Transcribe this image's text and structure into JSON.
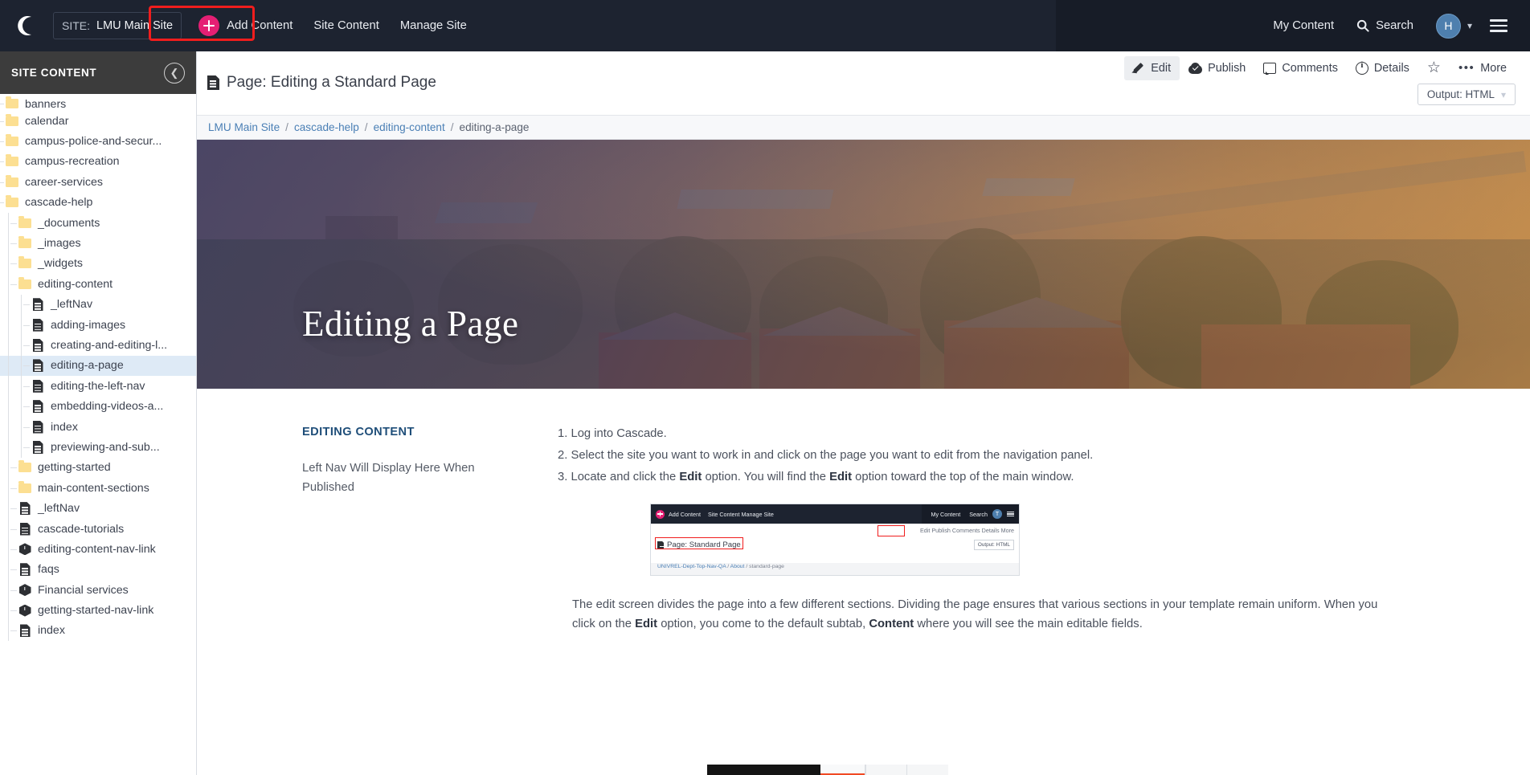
{
  "topbar": {
    "logo_icon": "crescent-moon-logo",
    "site_label": "SITE:",
    "site_value": "LMU Main Site",
    "add_content": "Add Content",
    "nav": [
      {
        "label": "Site Content"
      },
      {
        "label": "Manage Site"
      }
    ],
    "my_content": "My Content",
    "search": "Search",
    "avatar_initial": "H",
    "accent_pink": "#e51f74",
    "bar_bg": "#1d2330",
    "highlight_box_color": "#f01d1d"
  },
  "sidebar": {
    "header": "SITE CONTENT",
    "collapse_icon": "chevron-left-icon",
    "items": [
      {
        "label": "banners",
        "type": "folder",
        "depth": 1,
        "selected": false,
        "clipped": true
      },
      {
        "label": "calendar",
        "type": "folder",
        "depth": 1,
        "selected": false
      },
      {
        "label": "campus-police-and-secur...",
        "type": "folder",
        "depth": 1,
        "selected": false
      },
      {
        "label": "campus-recreation",
        "type": "folder",
        "depth": 1,
        "selected": false
      },
      {
        "label": "career-services",
        "type": "folder",
        "depth": 1,
        "selected": false
      },
      {
        "label": "cascade-help",
        "type": "folder",
        "depth": 1,
        "selected": false
      },
      {
        "label": "_documents",
        "type": "folder",
        "depth": 2,
        "selected": false
      },
      {
        "label": "_images",
        "type": "folder",
        "depth": 2,
        "selected": false
      },
      {
        "label": "_widgets",
        "type": "folder",
        "depth": 2,
        "selected": false
      },
      {
        "label": "editing-content",
        "type": "folder",
        "depth": 2,
        "selected": false
      },
      {
        "label": "_leftNav",
        "type": "page",
        "depth": 3,
        "selected": false
      },
      {
        "label": "adding-images",
        "type": "page",
        "depth": 3,
        "selected": false
      },
      {
        "label": "creating-and-editing-l...",
        "type": "page",
        "depth": 3,
        "selected": false
      },
      {
        "label": "editing-a-page",
        "type": "page",
        "depth": 3,
        "selected": true
      },
      {
        "label": "editing-the-left-nav",
        "type": "page",
        "depth": 3,
        "selected": false
      },
      {
        "label": "embedding-videos-a...",
        "type": "page",
        "depth": 3,
        "selected": false
      },
      {
        "label": "index",
        "type": "page",
        "depth": 3,
        "selected": false
      },
      {
        "label": "previewing-and-sub...",
        "type": "page",
        "depth": 3,
        "selected": false
      },
      {
        "label": "getting-started",
        "type": "folder",
        "depth": 2,
        "selected": false
      },
      {
        "label": "main-content-sections",
        "type": "folder",
        "depth": 2,
        "selected": false
      },
      {
        "label": "_leftNav",
        "type": "page",
        "depth": 2,
        "selected": false
      },
      {
        "label": "cascade-tutorials",
        "type": "page",
        "depth": 2,
        "selected": false
      },
      {
        "label": "editing-content-nav-link",
        "type": "block",
        "depth": 2,
        "selected": false
      },
      {
        "label": "faqs",
        "type": "page",
        "depth": 2,
        "selected": false
      },
      {
        "label": "Financial services",
        "type": "block",
        "depth": 2,
        "selected": false
      },
      {
        "label": "getting-started-nav-link",
        "type": "block",
        "depth": 2,
        "selected": false
      },
      {
        "label": "index",
        "type": "page",
        "depth": 2,
        "selected": false
      }
    ]
  },
  "page": {
    "title": "Page: Editing a Standard Page",
    "title_icon": "page-document-icon",
    "toolbar": [
      {
        "label": "Edit",
        "icon": "pencil-icon",
        "active": true
      },
      {
        "label": "Publish",
        "icon": "publish-icon",
        "active": false
      },
      {
        "label": "Comments",
        "icon": "comment-icon",
        "active": false
      },
      {
        "label": "Details",
        "icon": "info-icon",
        "active": false
      },
      {
        "label": "",
        "icon": "star-icon",
        "active": false
      },
      {
        "label": "More",
        "icon": "ellipsis-icon",
        "active": false
      }
    ],
    "output_selector": "Output: HTML",
    "breadcrumb": [
      {
        "label": "LMU Main Site",
        "link": true
      },
      {
        "label": "cascade-help",
        "link": true
      },
      {
        "label": "editing-content",
        "link": true
      },
      {
        "label": "editing-a-page",
        "link": false
      }
    ],
    "breadcrumb_separator": "/"
  },
  "hero": {
    "title": "Editing a Page",
    "alt": "aerial-campus-photo"
  },
  "body": {
    "section_label": "EDITING CONTENT",
    "left_nav_note": "Left Nav Will Display Here When Published",
    "steps": [
      "Log into Cascade.",
      "Select the site you want to work in and click on the page you want to edit from the navigation panel.",
      "Locate and click the Edit option. You will find the Edit option toward the top of the main window."
    ],
    "step3_parts": {
      "a": "Locate and click the ",
      "bold1": "Edit",
      "b": " option. You will find the ",
      "bold2": "Edit",
      "c": " option toward the top of the main window."
    },
    "paragraph_parts": {
      "a": "The edit screen divides the page into a few different sections. Dividing the page ensures that various sections in your template remain uniform. When you click on the ",
      "bold1": "Edit",
      "b": " option, you come to the default subtab, ",
      "bold2": "Content",
      "c": " where you will see the main editable fields."
    }
  },
  "embedded_screenshot": {
    "add_content": "Add Content",
    "nav": "Site Content    Manage Site",
    "my_content": "My Content",
    "search": "Search",
    "avatar_initial": "T",
    "tools": "Edit   Publish   Comments   Details   More",
    "page_title": "Page: Standard Page",
    "output": "Output: HTML",
    "breadcrumb_a": "UNIVREL-Dept-Top-Nav-QA",
    "breadcrumb_b": "About",
    "breadcrumb_c": "standard-page"
  }
}
